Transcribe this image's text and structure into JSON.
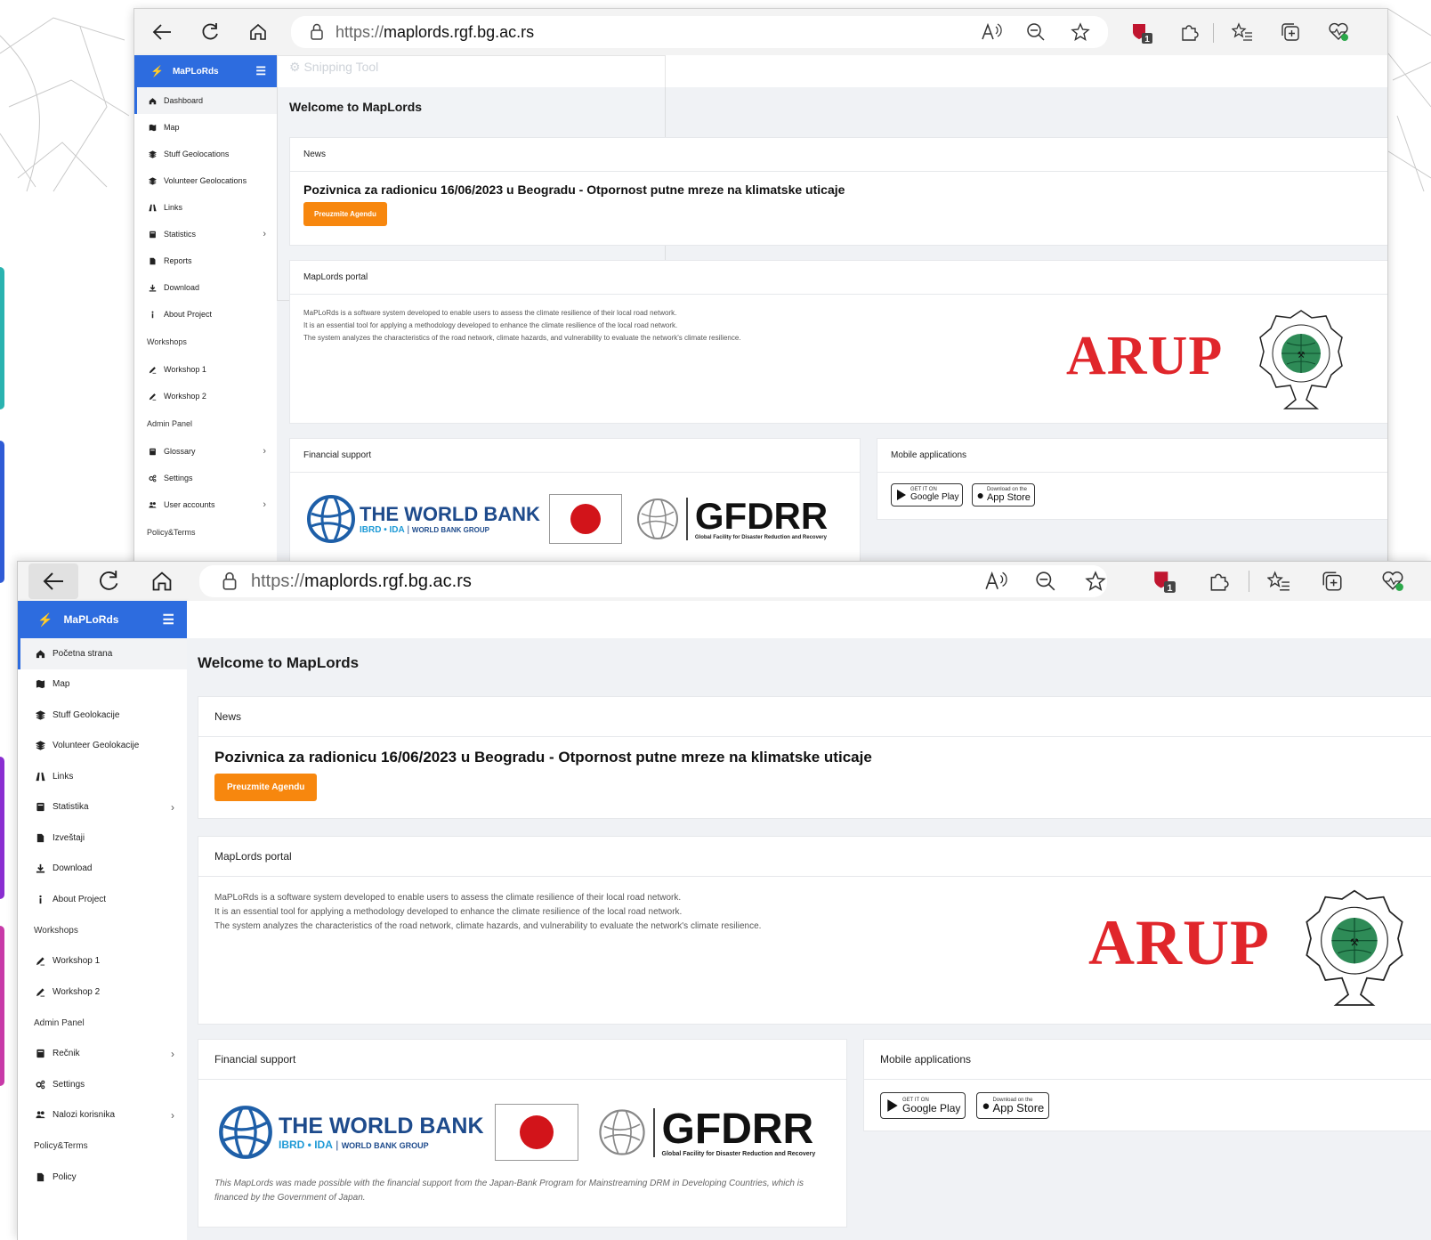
{
  "theme": {
    "brand_blue": "#2d6cdf",
    "accent_orange": "#f7870e",
    "arup_red": "#e0262b",
    "content_bg": "#f0f2f5"
  },
  "accents": [
    "#2ab3b0",
    "#2f5bd6",
    "#8a2ed1",
    "#c83aa8"
  ],
  "browser": {
    "url_protocol": "https://",
    "url_host": "maplords.rgf.bg.ac.rs",
    "badge_count": "1",
    "icons": [
      "back-icon",
      "refresh-icon",
      "home-icon",
      "lock-icon",
      "read-aloud-icon",
      "zoom-out-icon",
      "favorite-star-icon",
      "shield-extension-icon",
      "extensions-puzzle-icon",
      "favorites-list-icon",
      "collections-icon",
      "browser-health-icon"
    ]
  },
  "overlay": {
    "snipping_tool": "Snipping Tool"
  },
  "app": {
    "brand": "MaPLoRds"
  },
  "sidebar_en": {
    "items": [
      {
        "label": "Dashboard",
        "icon": "home-icon"
      },
      {
        "label": "Map",
        "icon": "map-icon"
      },
      {
        "label": "Stuff Geolocations",
        "icon": "layers-icon"
      },
      {
        "label": "Volunteer Geolocations",
        "icon": "layers-icon"
      },
      {
        "label": "Links",
        "icon": "road-icon"
      },
      {
        "label": "Statistics",
        "icon": "book-icon"
      },
      {
        "label": "Reports",
        "icon": "file-icon"
      },
      {
        "label": "Download",
        "icon": "download-icon"
      },
      {
        "label": "About Project",
        "icon": "info-icon"
      }
    ],
    "section_workshops": "Workshops",
    "workshops": [
      "Workshop 1",
      "Workshop 2"
    ],
    "section_admin": "Admin Panel",
    "admin": [
      {
        "label": "Glossary",
        "icon": "book-icon"
      },
      {
        "label": "Settings",
        "icon": "cogs-icon"
      },
      {
        "label": "User accounts",
        "icon": "users-icon"
      }
    ],
    "section_policy": "Policy&Terms"
  },
  "sidebar_sr": {
    "items": [
      {
        "label": "Početna strana",
        "icon": "home-icon"
      },
      {
        "label": "Map",
        "icon": "map-icon"
      },
      {
        "label": "Stuff Geolokacije",
        "icon": "layers-icon"
      },
      {
        "label": "Volunteer Geolokacije",
        "icon": "layers-icon"
      },
      {
        "label": "Links",
        "icon": "road-icon"
      },
      {
        "label": "Statistika",
        "icon": "book-icon"
      },
      {
        "label": "Izveštaji",
        "icon": "file-icon"
      },
      {
        "label": "Download",
        "icon": "download-icon"
      },
      {
        "label": "About Project",
        "icon": "info-icon"
      }
    ],
    "section_workshops": "Workshops",
    "workshops": [
      "Workshop 1",
      "Workshop 2"
    ],
    "section_admin": "Admin Panel",
    "admin": [
      {
        "label": "Rečnik",
        "icon": "book-icon"
      },
      {
        "label": "Settings",
        "icon": "cogs-icon"
      },
      {
        "label": "Nalozi korisnika",
        "icon": "users-icon"
      }
    ],
    "section_policy": "Policy&Terms",
    "policy": "Policy"
  },
  "content": {
    "page_title": "Welcome to MapLords",
    "news_header": "News",
    "news_title": "Pozivnica za radionicu 16/06/2023 u Beogradu - Otpornost putne mreze na klimatske uticaje",
    "news_button": "Preuzmite Agendu",
    "portal_header": "MapLords portal",
    "portal_lines": [
      "MaPLoRds is a software system developed to enable users to assess the climate resilience of their local road network.",
      "It is an essential tool for applying a methodology developed to enhance the climate resilience of the local road network.",
      "The system analyzes the characteristics of the road network, climate hazards, and vulnerability to evaluate the network's climate resilience."
    ],
    "arup": "ARUP",
    "seal_text": "УНИВЕРЗИТЕТ У БЕОГРАДУ РУДАРСКО-ГЕОЛОШКИ ФАКУЛТЕТ",
    "financial_header": "Financial support",
    "worldbank_name": "THE WORLD BANK",
    "worldbank_sub1": "IBRD • IDA",
    "worldbank_sub2": "WORLD BANK GROUP",
    "gfdrr": "GFDRR",
    "gfdrr_sub": "Global Facility for Disaster Reduction and Recovery",
    "financial_note": "This MapLords was made possible with the financial support from the Japan-Bank Program for Mainstreaming DRM in Developing Countries, which is financed by the Government of Japan.",
    "mobile_header": "Mobile applications",
    "google_small": "GET IT ON",
    "google_big": "Google Play",
    "apple_small": "Download on the",
    "apple_big": "App Store"
  }
}
